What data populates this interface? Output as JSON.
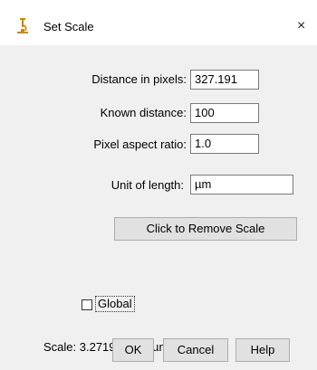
{
  "window": {
    "title": "Set Scale",
    "icon": "microscope-icon",
    "close_glyph": "×"
  },
  "form": {
    "distance_pixels": {
      "label": "Distance in pixels:",
      "value": "327.191"
    },
    "known_distance": {
      "label": "Known distance:",
      "value": "100"
    },
    "pixel_aspect": {
      "label": "Pixel aspect ratio:",
      "value": "1.0"
    },
    "unit": {
      "label": "Unit of length:",
      "value": "µm"
    }
  },
  "remove_scale_label": "Click to Remove Scale",
  "global": {
    "label": "Global",
    "checked": false
  },
  "scale_text": "Scale: 3.2719 pixels/µm",
  "buttons": {
    "ok": "OK",
    "cancel": "Cancel",
    "help": "Help"
  },
  "colors": {
    "dialog_bg": "#f0f0f0",
    "titlebar_bg": "#ffffff",
    "icon_accent": "#c58a00"
  }
}
